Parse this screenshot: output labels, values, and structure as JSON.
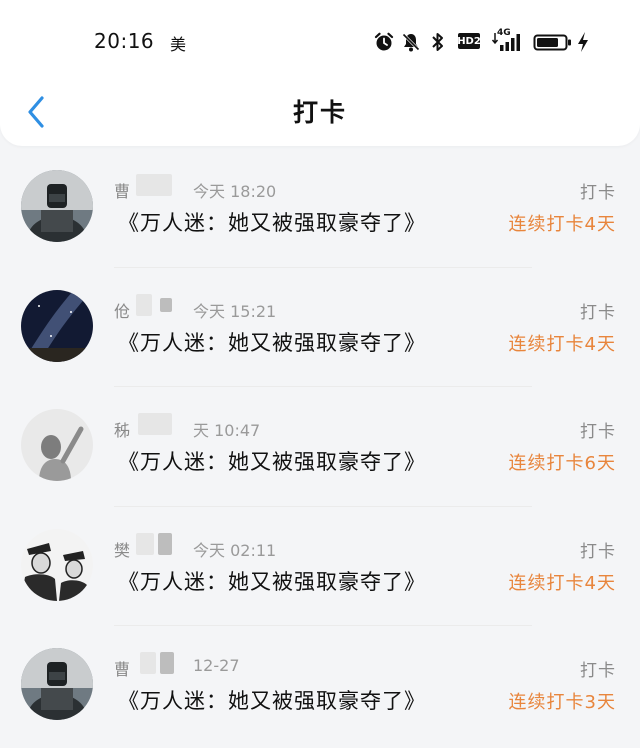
{
  "status_bar": {
    "time": "20:16",
    "carrier_icon": "美",
    "hd_label": "HD2",
    "network_label": "4G",
    "icons": [
      "alarm-icon",
      "mute-bell-icon",
      "bluetooth-icon",
      "signal-icon",
      "battery-icon",
      "charging-icon"
    ]
  },
  "header": {
    "title": "打卡",
    "back_icon": "chevron-left-icon"
  },
  "colors": {
    "accent_blue": "#2f8fe3",
    "streak_orange": "#e8853c",
    "muted_gray": "#8a8a8a"
  },
  "rows": [
    {
      "name": "曹",
      "time": "今天 18:20",
      "book": "《万人迷：她又被强取豪夺了》",
      "tag": "打卡",
      "streak": "连续打卡4天"
    },
    {
      "name": "伧",
      "time": "今天 15:21",
      "book": "《万人迷：她又被强取豪夺了》",
      "tag": "打卡",
      "streak": "连续打卡4天"
    },
    {
      "name": "秭",
      "time": "天 10:47",
      "book": "《万人迷：她又被强取豪夺了》",
      "tag": "打卡",
      "streak": "连续打卡6天"
    },
    {
      "name": "樊",
      "time": "今天 02:11",
      "book": "《万人迷：她又被强取豪夺了》",
      "tag": "打卡",
      "streak": "连续打卡4天"
    },
    {
      "name": "曹",
      "time": "12-27",
      "book": "《万人迷：她又被强取豪夺了》",
      "tag": "打卡",
      "streak": "连续打卡3天"
    }
  ]
}
